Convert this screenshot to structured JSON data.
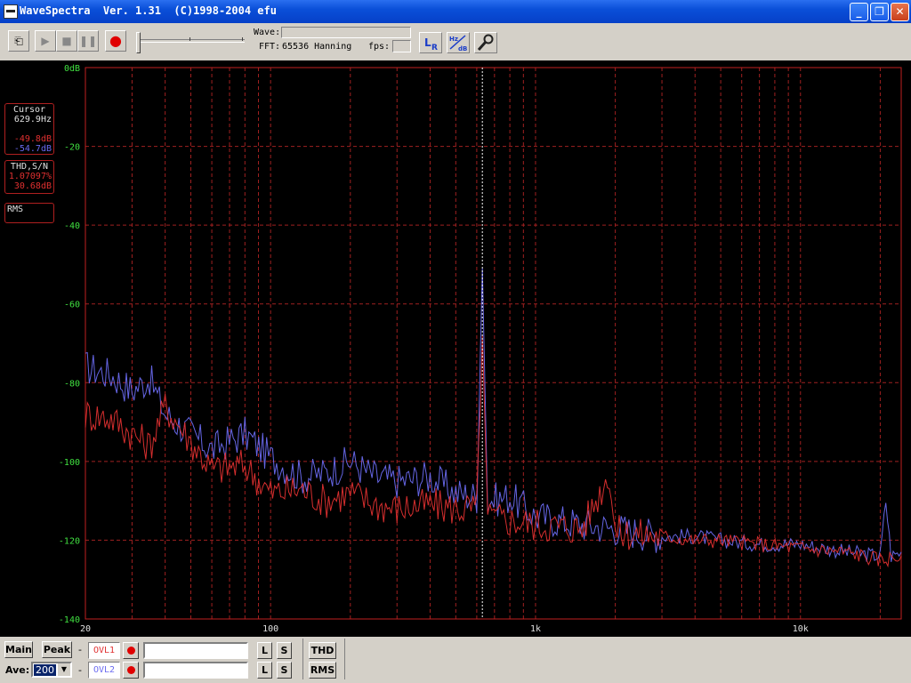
{
  "window": {
    "title": "WaveSpectra  Ver. 1.31  (C)1998-2004 efu"
  },
  "toolbar": {
    "wave_label": "Wave:",
    "fft_label": "FFT:",
    "fft_value": "65536 Hanning",
    "fps_label": "fps:"
  },
  "colors": {
    "ch1": "#e03030",
    "ch2": "#6a6af0",
    "grid": "#a02020",
    "axis_text": "#40e040",
    "border": "#c02020"
  },
  "side": {
    "cursor_title": "Cursor",
    "cursor_freq": "629.9Hz",
    "cursor_l": "-49.8dB",
    "cursor_r": "-54.7dB",
    "thd_title": "THD,S/N",
    "thd_value": "1.07097%",
    "sn_value": "30.68dB",
    "rms_title": "RMS"
  },
  "chart_data": {
    "type": "line",
    "x_scale": "log",
    "xlim": [
      20,
      24000
    ],
    "ylim": [
      -140,
      0
    ],
    "y_ticks": [
      "0dB",
      "-20",
      "-40",
      "-60",
      "-80",
      "-100",
      "-120",
      "-140"
    ],
    "x_ticks": [
      "20",
      "100",
      "1k",
      "10k"
    ],
    "cursor_x": 629.9,
    "series": [
      {
        "color": "#6a6af0",
        "x": [
          20,
          25,
          30,
          35,
          40,
          50,
          60,
          80,
          100,
          130,
          160,
          200,
          250,
          300,
          400,
          500,
          600,
          630,
          660,
          800,
          1000,
          1500,
          2000,
          3000,
          4000,
          5000,
          7000,
          10000,
          15000,
          20000,
          21000,
          22000,
          24000
        ],
        "y": [
          -76,
          -78,
          -82,
          -79,
          -88,
          -93,
          -97,
          -93,
          -99,
          -104,
          -103,
          -100,
          -104,
          -105,
          -104,
          -108,
          -109,
          -51,
          -110,
          -109,
          -114,
          -116,
          -117,
          -119,
          -119,
          -120,
          -121,
          -121,
          -123,
          -124,
          -110,
          -124,
          -123
        ]
      },
      {
        "color": "#e03030",
        "x": [
          20,
          25,
          30,
          35,
          40,
          50,
          60,
          80,
          100,
          130,
          160,
          200,
          250,
          300,
          400,
          500,
          600,
          630,
          660,
          800,
          1000,
          1500,
          1900,
          2000,
          3000,
          4000,
          5000,
          7000,
          10000,
          15000,
          20000,
          24000
        ],
        "y": [
          -88,
          -89,
          -93,
          -96,
          -86,
          -95,
          -102,
          -101,
          -108,
          -107,
          -110,
          -108,
          -111,
          -112,
          -111,
          -112,
          -112,
          -68,
          -114,
          -115,
          -116,
          -117,
          -103,
          -118,
          -119,
          -120,
          -120,
          -121,
          -122,
          -123,
          -125,
          -124
        ]
      }
    ]
  },
  "bottom": {
    "main_label": "Main",
    "peak_label": "Peak",
    "ave_label": "Ave:",
    "ave_value": "200",
    "dash": "-",
    "ovl1": "OVL1",
    "ovl2": "OVL2",
    "l_label": "L",
    "s_label": "S",
    "thd_btn": "THD",
    "rms_btn": "RMS"
  }
}
